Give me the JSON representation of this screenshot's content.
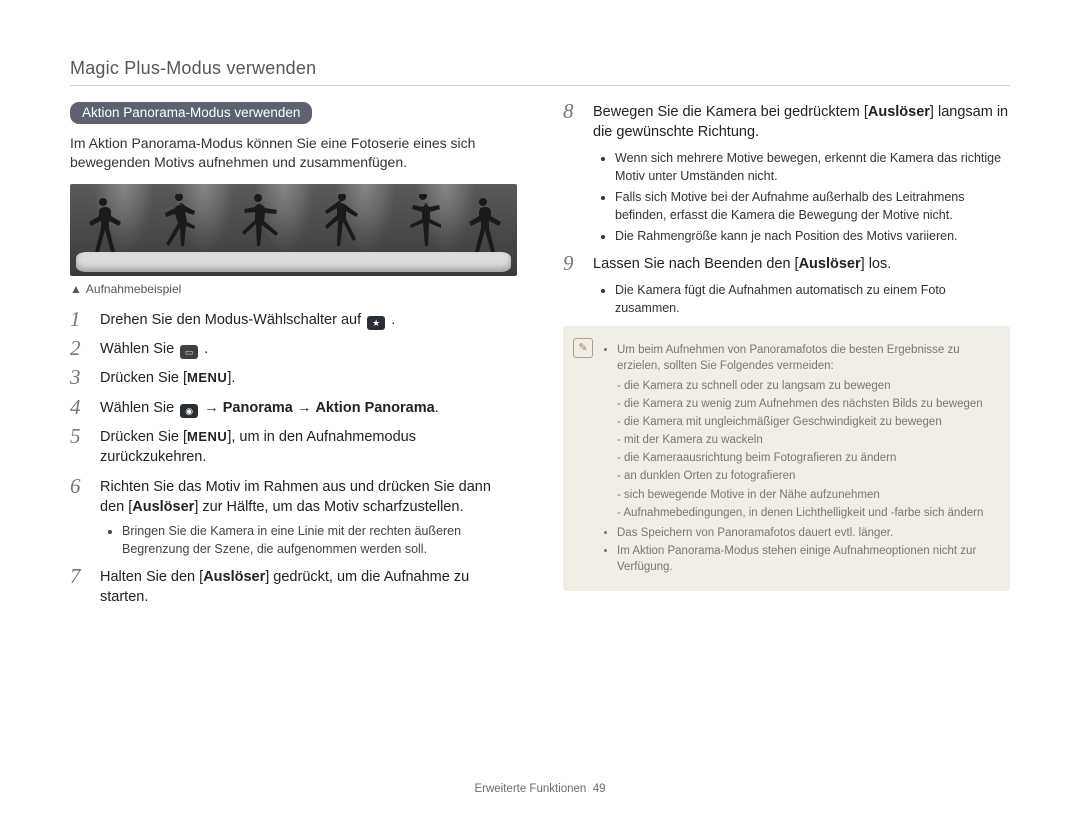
{
  "page_title": "Magic Plus-Modus verwenden",
  "section_pill": "Aktion Panorama-Modus verwenden",
  "intro": "Im Aktion Panorama-Modus können Sie eine Fotoserie eines sich bewegenden Motivs aufnehmen und zusammenfügen.",
  "caption": "Aufnahmebeispiel",
  "icons": {
    "mode_dial": "★",
    "panorama_icon": "▭",
    "camera_icon": "◉",
    "menu": "MENU",
    "note": "✎"
  },
  "steps_left": {
    "s1_pre": "Drehen Sie den Modus-Wählschalter auf ",
    "s1_post": ".",
    "s2_pre": "Wählen Sie ",
    "s2_post": ".",
    "s3_pre": "Drücken Sie [",
    "s3_post": "].",
    "s4_pre": "Wählen Sie ",
    "s4_mid": " → ",
    "s4_b1": "Panorama",
    "s4_b2": "Aktion Panorama",
    "s4_post": ".",
    "s5_pre": "Drücken Sie [",
    "s5_post": "], um in den Aufnahmemodus zurückzukehren.",
    "s6_a": "Richten Sie das Motiv im Rahmen aus und drücken Sie dann den [",
    "s6_b": "Auslöser",
    "s6_c": "] zur Hälfte, um das Motiv scharfzustellen.",
    "s6_bullet": "Bringen Sie die Kamera in eine Linie mit der rechten äußeren Begrenzung der Szene, die aufgenommen werden soll.",
    "s7_a": "Halten Sie den [",
    "s7_b": "Auslöser",
    "s7_c": "] gedrückt, um die Aufnahme zu starten."
  },
  "steps_right": {
    "s8_a": "Bewegen Sie die Kamera bei gedrücktem [",
    "s8_b": "Auslöser",
    "s8_c": "] langsam in die gewünschte Richtung.",
    "s8_bullets": [
      "Wenn sich mehrere Motive bewegen, erkennt die Kamera das richtige Motiv unter Umständen nicht.",
      "Falls sich Motive bei der Aufnahme außerhalb des Leitrahmens befinden, erfasst die Kamera die Bewegung der Motive nicht.",
      "Die Rahmengröße kann je nach Position des Motivs variieren."
    ],
    "s9_a": "Lassen Sie nach Beenden den [",
    "s9_b": "Auslöser",
    "s9_c": "] los.",
    "s9_bullet": "Die Kamera fügt die Aufnahmen automatisch zu einem Foto zusammen."
  },
  "note": {
    "lead": "Um beim Aufnehmen von Panoramafotos die besten Ergebnisse zu erzielen, sollten Sie Folgendes vermeiden:",
    "dashes": [
      "die Kamera zu schnell oder zu langsam zu bewegen",
      "die Kamera zu wenig zum Aufnehmen des nächsten Bilds zu bewegen",
      "die Kamera mit ungleichmäßiger Geschwindigkeit zu bewegen",
      "mit der Kamera zu wackeln",
      "die Kameraausrichtung beim Fotografieren zu ändern",
      "an dunklen Orten zu fotografieren",
      "sich bewegende Motive in der Nähe aufzunehmen",
      "Aufnahmebedingungen, in denen Lichthelligkeit und -farbe sich ändern"
    ],
    "extra": [
      "Das Speichern von Panoramafotos dauert evtl. länger.",
      "Im Aktion Panorama-Modus stehen einige Aufnahmeoptionen nicht zur Verfügung."
    ]
  },
  "footer": {
    "section": "Erweiterte Funktionen",
    "page": "49"
  }
}
